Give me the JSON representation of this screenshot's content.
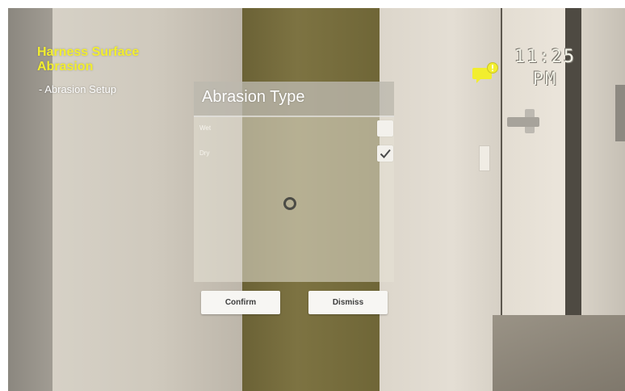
{
  "hud": {
    "title": "Harness Surface Abrasion",
    "subtitle": "- Abrasion Setup",
    "clock_time": "11:25",
    "clock_period": "PM",
    "notification_icon": "chat-bubble-alert-icon",
    "accent_color": "#f2ee2e"
  },
  "dialog": {
    "title": "Abrasion Type",
    "options": [
      {
        "label": "Wet",
        "checked": false
      },
      {
        "label": "Dry",
        "checked": true
      }
    ]
  },
  "buttons": {
    "confirm": "Confirm",
    "dismiss": "Dismiss"
  }
}
